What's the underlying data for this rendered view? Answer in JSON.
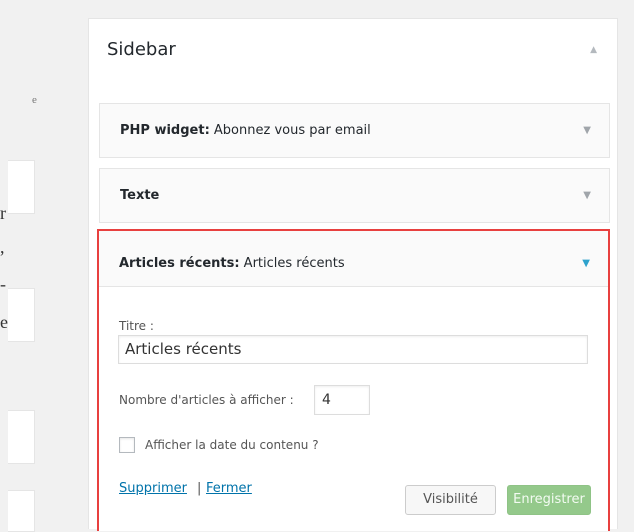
{
  "left_column": {
    "fragments": [
      "r",
      ",",
      "-",
      "e"
    ],
    "small_fragment": "e"
  },
  "sidebar": {
    "title": "Sidebar",
    "collapse_icon": "triangle-up",
    "widgets": [
      {
        "label_bold": "PHP widget:",
        "label_rest": " Abonnez vous par email",
        "toggle_icon": "triangle-down"
      },
      {
        "label_bold": "Texte",
        "label_rest": "",
        "toggle_icon": "triangle-down"
      },
      {
        "label_bold": "Articles récents:",
        "label_rest": " Articles récents",
        "toggle_icon": "triangle-down",
        "expanded": true,
        "highlight_color": "#e8403f",
        "form": {
          "title_label": "Titre :",
          "title_value": "Articles récents",
          "count_label": "Nombre d'articles à afficher :",
          "count_value": "4",
          "show_date_label": "Afficher la date du contenu ?",
          "show_date_checked": false,
          "delete_link": "Supprimer",
          "link_separator": "|",
          "close_link": "Fermer",
          "visibility_button": "Visibilité",
          "save_button": "Enregistrer"
        }
      }
    ]
  }
}
